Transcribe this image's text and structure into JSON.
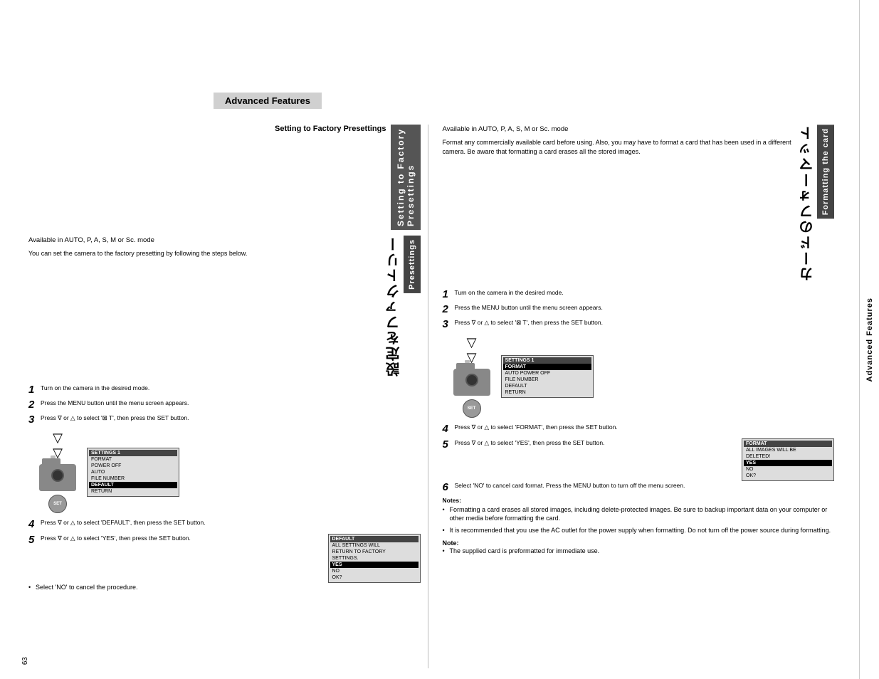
{
  "page": {
    "page_number": "63",
    "sidebar_label": "Advanced Features"
  },
  "banner": {
    "text": "Advanced Features"
  },
  "right_column_header": "Advanced Features",
  "left_section": {
    "title_jp": "設定をファクトリー",
    "title_en": "Setting to Factory Presettings",
    "availability": "Available in AUTO, P, A, S, M or Sc. mode",
    "intro": "You can set the camera to the factory presetting by following the steps below.",
    "steps": [
      {
        "num": "1",
        "text": "Turn on the camera in the desired mode."
      },
      {
        "num": "2",
        "text": "Press the MENU button until the menu screen appears."
      },
      {
        "num": "3",
        "text": "Press ∇ or △ to select '⊠ T', then press the SET button."
      },
      {
        "num": "4",
        "text": "Press ∇ or △ to select 'DEFAULT', then press the SET button."
      },
      {
        "num": "5",
        "text": "Press ∇ or △ to select 'YES', then press the SET button."
      }
    ],
    "menu1": {
      "title": "SETTINGS 1",
      "rows": [
        "FORMAT",
        "POWER OFF",
        "AUTO",
        "FILE NUMBER",
        "DEFAULT",
        "RETURN"
      ],
      "selected": "DEFAULT"
    },
    "menu2": {
      "title": "DEFAULT",
      "rows": [
        "ALL SETTINGS WILL",
        "RETURN TO FACTORY",
        "SETTINGS.",
        "YES",
        "NO",
        "OK?"
      ],
      "selected": "YES"
    },
    "bullet": "Select 'NO' to cancel the procedure."
  },
  "right_section": {
    "title_jp": "カードのフォーマット",
    "title_en": "Formatting the card",
    "availability": "Available in AUTO, P, A, S, M or Sc. mode",
    "intro": "Format any commercially available card before using. Also, you may have to format a card that has been used in a different camera. Be aware that formatting a card erases all the stored images.",
    "steps": [
      {
        "num": "1",
        "text": "Turn on the camera in the desired mode."
      },
      {
        "num": "2",
        "text": "Press the MENU button until the menu screen appears."
      },
      {
        "num": "3",
        "text": "Press ∇ or △ to select '⊠ T', then press the SET button."
      },
      {
        "num": "4",
        "text": "Press ∇ or △ to select 'FORMAT', then press the SET button."
      },
      {
        "num": "5",
        "text": "Press ∇ or △ to select 'YES', then press the SET button."
      },
      {
        "num": "6",
        "text": "Select 'NO' to cancel card format. Press the MENU button to turn off the menu screen."
      }
    ],
    "menu1": {
      "title": "SETTINGS 1",
      "rows": [
        "FORMAT",
        "AUTO POWER OFF",
        "FILE NUMBER",
        "DEFAULT",
        "RETURN"
      ],
      "selected": "FORMAT"
    },
    "menu2": {
      "title": "FORMAT",
      "rows": [
        "ALL IMAGES WILL BE",
        "DELETED!",
        "YES",
        "NO",
        "OK?"
      ],
      "selected": "YES"
    },
    "notes_label": "Notes:",
    "notes": [
      "Formatting a card erases all stored images, including delete-protected images. Be sure to backup important data on your computer or other media before formatting the card.",
      "It is recommended that you use the AC outlet for the power supply when formatting. Do not turn off the power source during formatting."
    ],
    "note_label": "Note:",
    "note_items": [
      "The supplied card is preformatted for immediate use."
    ]
  }
}
